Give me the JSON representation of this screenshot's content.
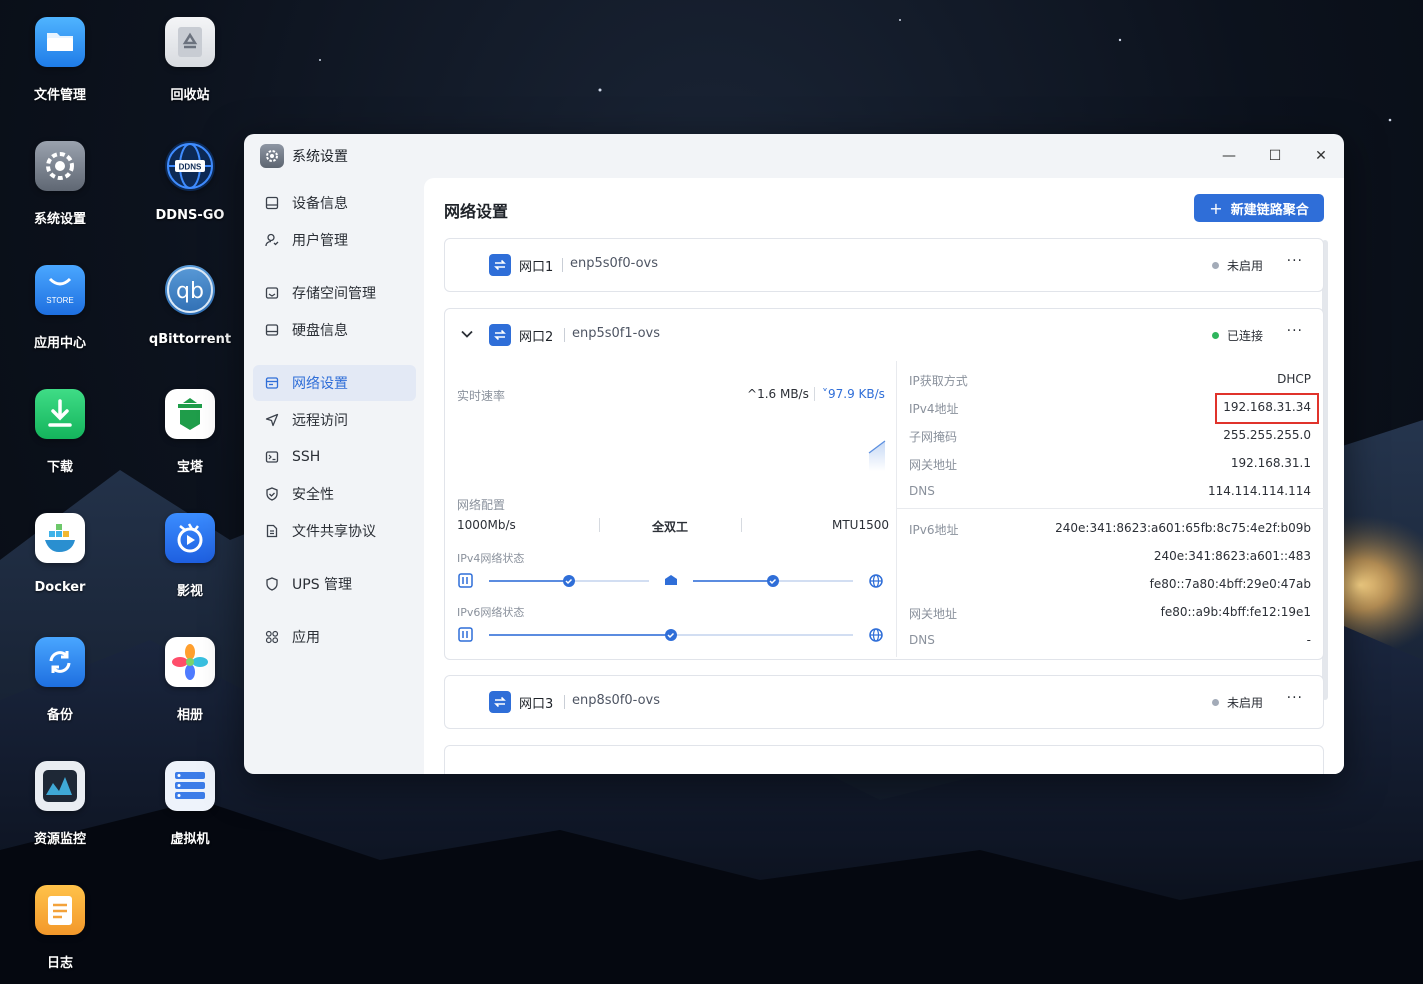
{
  "desktop": {
    "icons": [
      {
        "label": "文件管理",
        "icon": "folder-icon"
      },
      {
        "label": "回收站",
        "icon": "recycle-bin-icon"
      },
      {
        "label": "系统设置",
        "icon": "settings-gear-icon"
      },
      {
        "label": "DDNS-GO",
        "icon": "ddns-globe-icon",
        "badge": "DDNS"
      },
      {
        "label": "应用中心",
        "icon": "store-icon",
        "badge": "STORE"
      },
      {
        "label": "qBittorrent",
        "icon": "qbittorrent-icon",
        "badge": "qb"
      },
      {
        "label": "下载",
        "icon": "download-icon"
      },
      {
        "label": "宝塔",
        "icon": "baota-icon"
      },
      {
        "label": "Docker",
        "icon": "docker-icon"
      },
      {
        "label": "影视",
        "icon": "video-icon"
      },
      {
        "label": "备份",
        "icon": "backup-icon"
      },
      {
        "label": "相册",
        "icon": "photos-icon"
      },
      {
        "label": "资源监控",
        "icon": "monitor-icon"
      },
      {
        "label": "虚拟机",
        "icon": "vm-icon"
      },
      {
        "label": "日志",
        "icon": "log-icon"
      }
    ]
  },
  "window": {
    "title": "系统设置",
    "controls": {
      "minimize": "—",
      "maximize": "☐",
      "close": "✕"
    }
  },
  "sidebar": {
    "items": [
      {
        "label": "设备信息",
        "icon": "device-info-icon"
      },
      {
        "label": "用户管理",
        "icon": "user-icon"
      },
      {
        "label": "存储空间管理",
        "icon": "storage-icon"
      },
      {
        "label": "硬盘信息",
        "icon": "disk-icon"
      },
      {
        "label": "网络设置",
        "icon": "network-icon",
        "active": true
      },
      {
        "label": "远程访问",
        "icon": "remote-access-icon"
      },
      {
        "label": "SSH",
        "icon": "terminal-icon"
      },
      {
        "label": "安全性",
        "icon": "shield-check-icon"
      },
      {
        "label": "文件共享协议",
        "icon": "file-share-icon"
      },
      {
        "label": "UPS 管理",
        "icon": "ups-shield-icon"
      },
      {
        "label": "应用",
        "icon": "apps-icon"
      }
    ]
  },
  "main": {
    "title": "网络设置",
    "new_aggregate_button": "新建链路聚合",
    "ports": [
      {
        "name": "网口1",
        "device": "enp5s0f0-ovs",
        "status": "未启用",
        "status_color": "#a3abb8",
        "more": "···"
      },
      {
        "name": "网口2",
        "device": "enp5s0f1-ovs",
        "status": "已连接",
        "status_color": "#2fb55d",
        "more": "···",
        "speed": {
          "label": "实时速率",
          "up": "1.6 MB/s",
          "down": "97.9 KB/s"
        },
        "config": {
          "label": "网络配置",
          "link_speed": "1000Mb/s",
          "duplex": "全双工",
          "mtu": "MTU1500"
        },
        "ipv4_state_label": "IPv4网络状态",
        "ipv6_state_label": "IPv6网络状态",
        "ipv4": [
          {
            "key": "IP获取方式",
            "value": "DHCP"
          },
          {
            "key": "IPv4地址",
            "value": "192.168.31.34"
          },
          {
            "key": "子网掩码",
            "value": "255.255.255.0"
          },
          {
            "key": "网关地址",
            "value": "192.168.31.1"
          },
          {
            "key": "DNS",
            "value": "114.114.114.114"
          }
        ],
        "ipv6": {
          "address_label": "IPv6地址",
          "addresses": [
            "240e:341:8623:a601:65fb:8c75:4e2f:b09b",
            "240e:341:8623:a601::483",
            "fe80::7a80:4bff:29e0:47ab"
          ],
          "gateway_label": "网关地址",
          "gateway": "fe80::a9b:4bff:fe12:19e1",
          "dns_label": "DNS",
          "dns": "-"
        }
      },
      {
        "name": "网口3",
        "device": "enp8s0f0-ovs",
        "status": "未启用",
        "status_color": "#a3abb8",
        "more": "···"
      }
    ]
  },
  "colors": {
    "accent": "#2f6ed8",
    "highlight": "#e0332b"
  }
}
